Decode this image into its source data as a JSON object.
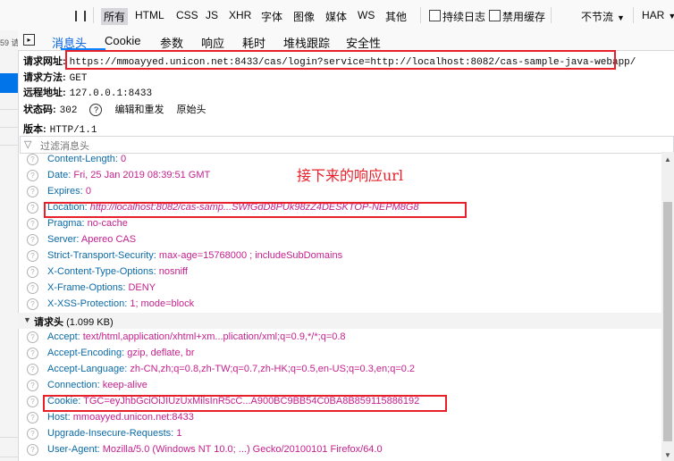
{
  "toolbar": {
    "pause": "❙❙",
    "filters": [
      "所有",
      "HTML",
      "CSS",
      "JS",
      "XHR",
      "字体",
      "图像",
      "媒体",
      "WS",
      "其他"
    ],
    "persist_log": "持续日志",
    "disable_cache": "禁用缓存",
    "throttle": "不节流",
    "har": "HAR"
  },
  "left_strip": {
    "count": "59 请"
  },
  "tabs": [
    "消息头",
    "Cookie",
    "参数",
    "响应",
    "耗时",
    "堆栈跟踪",
    "安全性"
  ],
  "summary": {
    "url_label": "请求网址:",
    "url": "https://mmoayyed.unicon.net:8433/cas/login?service=http://localhost:8082/cas-sample-java-webapp/",
    "method_label": "请求方法:",
    "method": "GET",
    "remote_label": "远程地址:",
    "remote": "127.0.0.1:8433",
    "status_label": "状态码:",
    "status": "302",
    "edit_resend": "编辑和重发",
    "raw": "原始头",
    "version_label": "版本:",
    "version": "HTTP/1.1"
  },
  "filter": {
    "placeholder": "过滤消息头"
  },
  "response_headers": [
    {
      "name": "Content-Length:",
      "value": "0"
    },
    {
      "name": "Date:",
      "value": "Fri, 25 Jan 2019 08:39:51 GMT"
    },
    {
      "name": "Expires:",
      "value": "0"
    },
    {
      "name": "Location:",
      "value": "http://localhost:8082/cas-samp...SWfGdD8PUk98zZ4DESKTOP-NEPM8G8"
    },
    {
      "name": "Pragma:",
      "value": "no-cache"
    },
    {
      "name": "Server:",
      "value": "Apereo CAS"
    },
    {
      "name": "Strict-Transport-Security:",
      "value": "max-age=15768000 ; includeSubDomains"
    },
    {
      "name": "X-Content-Type-Options:",
      "value": "nosniff"
    },
    {
      "name": "X-Frame-Options:",
      "value": "DENY"
    },
    {
      "name": "X-XSS-Protection:",
      "value": "1; mode=block"
    }
  ],
  "request_section": {
    "title": "请求头",
    "size": "(1.099 KB)"
  },
  "request_headers": [
    {
      "name": "Accept:",
      "value": "text/html,application/xhtml+xm...plication/xml;q=0.9,*/*;q=0.8"
    },
    {
      "name": "Accept-Encoding:",
      "value": "gzip, deflate, br"
    },
    {
      "name": "Accept-Language:",
      "value": "zh-CN,zh;q=0.8,zh-TW;q=0.7,zh-HK;q=0.5,en-US;q=0.3,en;q=0.2"
    },
    {
      "name": "Connection:",
      "value": "keep-alive"
    },
    {
      "name": "Cookie:",
      "value": "TGC=eyJhbGciOiJIUzUxMilsInR5cC...A900BC9BB54C0BA8B859115886192"
    },
    {
      "name": "Host:",
      "value": "mmoayyed.unicon.net:8433"
    },
    {
      "name": "Upgrade-Insecure-Requests:",
      "value": "1"
    },
    {
      "name": "User-Agent:",
      "value": "Mozilla/5.0 (Windows NT 10.0; ...) Gecko/20100101 Firefox/64.0"
    }
  ],
  "annotation": "接下来的响应url",
  "colors": {
    "highlight_box": "#e8202a",
    "header_name": "#0b6aa6",
    "header_value": "#c5218e",
    "active_tab": "#0060df"
  }
}
